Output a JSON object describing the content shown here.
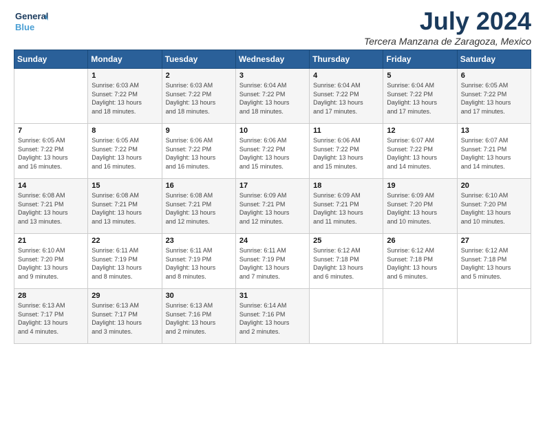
{
  "header": {
    "logo_line1": "General",
    "logo_line2": "Blue",
    "month": "July 2024",
    "location": "Tercera Manzana de Zaragoza, Mexico"
  },
  "days_of_week": [
    "Sunday",
    "Monday",
    "Tuesday",
    "Wednesday",
    "Thursday",
    "Friday",
    "Saturday"
  ],
  "weeks": [
    [
      {
        "day": "",
        "info": ""
      },
      {
        "day": "1",
        "info": "Sunrise: 6:03 AM\nSunset: 7:22 PM\nDaylight: 13 hours\nand 18 minutes."
      },
      {
        "day": "2",
        "info": "Sunrise: 6:03 AM\nSunset: 7:22 PM\nDaylight: 13 hours\nand 18 minutes."
      },
      {
        "day": "3",
        "info": "Sunrise: 6:04 AM\nSunset: 7:22 PM\nDaylight: 13 hours\nand 18 minutes."
      },
      {
        "day": "4",
        "info": "Sunrise: 6:04 AM\nSunset: 7:22 PM\nDaylight: 13 hours\nand 17 minutes."
      },
      {
        "day": "5",
        "info": "Sunrise: 6:04 AM\nSunset: 7:22 PM\nDaylight: 13 hours\nand 17 minutes."
      },
      {
        "day": "6",
        "info": "Sunrise: 6:05 AM\nSunset: 7:22 PM\nDaylight: 13 hours\nand 17 minutes."
      }
    ],
    [
      {
        "day": "7",
        "info": "Sunrise: 6:05 AM\nSunset: 7:22 PM\nDaylight: 13 hours\nand 16 minutes."
      },
      {
        "day": "8",
        "info": "Sunrise: 6:05 AM\nSunset: 7:22 PM\nDaylight: 13 hours\nand 16 minutes."
      },
      {
        "day": "9",
        "info": "Sunrise: 6:06 AM\nSunset: 7:22 PM\nDaylight: 13 hours\nand 16 minutes."
      },
      {
        "day": "10",
        "info": "Sunrise: 6:06 AM\nSunset: 7:22 PM\nDaylight: 13 hours\nand 15 minutes."
      },
      {
        "day": "11",
        "info": "Sunrise: 6:06 AM\nSunset: 7:22 PM\nDaylight: 13 hours\nand 15 minutes."
      },
      {
        "day": "12",
        "info": "Sunrise: 6:07 AM\nSunset: 7:22 PM\nDaylight: 13 hours\nand 14 minutes."
      },
      {
        "day": "13",
        "info": "Sunrise: 6:07 AM\nSunset: 7:21 PM\nDaylight: 13 hours\nand 14 minutes."
      }
    ],
    [
      {
        "day": "14",
        "info": "Sunrise: 6:08 AM\nSunset: 7:21 PM\nDaylight: 13 hours\nand 13 minutes."
      },
      {
        "day": "15",
        "info": "Sunrise: 6:08 AM\nSunset: 7:21 PM\nDaylight: 13 hours\nand 13 minutes."
      },
      {
        "day": "16",
        "info": "Sunrise: 6:08 AM\nSunset: 7:21 PM\nDaylight: 13 hours\nand 12 minutes."
      },
      {
        "day": "17",
        "info": "Sunrise: 6:09 AM\nSunset: 7:21 PM\nDaylight: 13 hours\nand 12 minutes."
      },
      {
        "day": "18",
        "info": "Sunrise: 6:09 AM\nSunset: 7:21 PM\nDaylight: 13 hours\nand 11 minutes."
      },
      {
        "day": "19",
        "info": "Sunrise: 6:09 AM\nSunset: 7:20 PM\nDaylight: 13 hours\nand 10 minutes."
      },
      {
        "day": "20",
        "info": "Sunrise: 6:10 AM\nSunset: 7:20 PM\nDaylight: 13 hours\nand 10 minutes."
      }
    ],
    [
      {
        "day": "21",
        "info": "Sunrise: 6:10 AM\nSunset: 7:20 PM\nDaylight: 13 hours\nand 9 minutes."
      },
      {
        "day": "22",
        "info": "Sunrise: 6:11 AM\nSunset: 7:19 PM\nDaylight: 13 hours\nand 8 minutes."
      },
      {
        "day": "23",
        "info": "Sunrise: 6:11 AM\nSunset: 7:19 PM\nDaylight: 13 hours\nand 8 minutes."
      },
      {
        "day": "24",
        "info": "Sunrise: 6:11 AM\nSunset: 7:19 PM\nDaylight: 13 hours\nand 7 minutes."
      },
      {
        "day": "25",
        "info": "Sunrise: 6:12 AM\nSunset: 7:18 PM\nDaylight: 13 hours\nand 6 minutes."
      },
      {
        "day": "26",
        "info": "Sunrise: 6:12 AM\nSunset: 7:18 PM\nDaylight: 13 hours\nand 6 minutes."
      },
      {
        "day": "27",
        "info": "Sunrise: 6:12 AM\nSunset: 7:18 PM\nDaylight: 13 hours\nand 5 minutes."
      }
    ],
    [
      {
        "day": "28",
        "info": "Sunrise: 6:13 AM\nSunset: 7:17 PM\nDaylight: 13 hours\nand 4 minutes."
      },
      {
        "day": "29",
        "info": "Sunrise: 6:13 AM\nSunset: 7:17 PM\nDaylight: 13 hours\nand 3 minutes."
      },
      {
        "day": "30",
        "info": "Sunrise: 6:13 AM\nSunset: 7:16 PM\nDaylight: 13 hours\nand 2 minutes."
      },
      {
        "day": "31",
        "info": "Sunrise: 6:14 AM\nSunset: 7:16 PM\nDaylight: 13 hours\nand 2 minutes."
      },
      {
        "day": "",
        "info": ""
      },
      {
        "day": "",
        "info": ""
      },
      {
        "day": "",
        "info": ""
      }
    ]
  ]
}
